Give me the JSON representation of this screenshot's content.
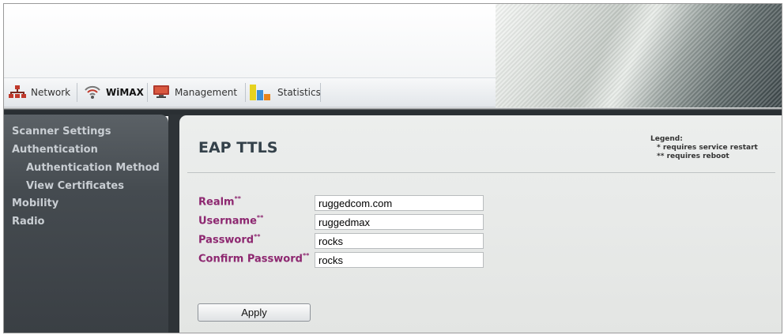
{
  "nav": {
    "tabs": [
      {
        "label": "Network",
        "icon": "network-icon"
      },
      {
        "label": "WiMAX",
        "icon": "wifi-signal-icon",
        "active": true
      },
      {
        "label": "Management",
        "icon": "monitor-icon"
      },
      {
        "label": "Statistics",
        "icon": "bar-chart-icon"
      }
    ]
  },
  "sidebar": {
    "items": [
      {
        "label": "Scanner Settings"
      },
      {
        "label": "Authentication"
      },
      {
        "label": "Authentication Method"
      },
      {
        "label": "View Certificates"
      },
      {
        "label": "Mobility"
      },
      {
        "label": "Radio"
      }
    ]
  },
  "page": {
    "title": "EAP TTLS",
    "legend": {
      "title": "Legend:",
      "star1_marker": "*",
      "star1_text": "requires service restart",
      "star2_marker": "**",
      "star2_text": "requires reboot"
    }
  },
  "form": {
    "fields": [
      {
        "label": "Realm",
        "marker": "**",
        "value": "ruggedcom.com"
      },
      {
        "label": "Username",
        "marker": "**",
        "value": "ruggedmax"
      },
      {
        "label": "Password",
        "marker": "**",
        "value": "rocks"
      },
      {
        "label": "Confirm Password",
        "marker": "**",
        "value": "rocks"
      }
    ],
    "apply_label": "Apply"
  },
  "colors": {
    "label_purple": "#8d2770",
    "sidebar_dark": "#3a3f44",
    "title_color": "#34414a"
  }
}
